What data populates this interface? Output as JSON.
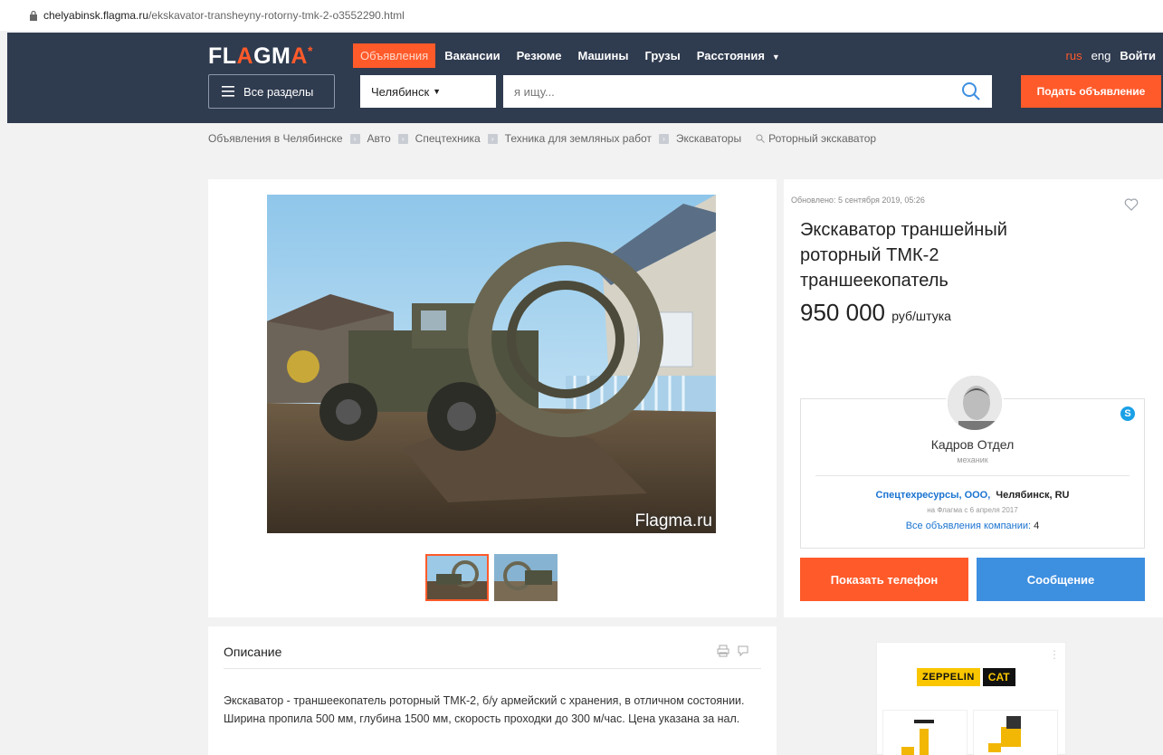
{
  "url": {
    "host": "chelyabinsk.flagma.ru",
    "path": "/ekskavator-transheyny-rotorny-tmk-2-o3552290.html"
  },
  "header": {
    "logo": "FLAGMA",
    "nav": [
      "Объявления",
      "Вакансии",
      "Резюме",
      "Машины",
      "Грузы",
      "Расстояния"
    ],
    "lang_rus": "rus",
    "lang_eng": "eng",
    "login": "Войти",
    "sections": "Все разделы",
    "city": "Челябинск",
    "search_placeholder": "я ищу...",
    "post_ad": "Подать объявление"
  },
  "breadcrumb": [
    "Объявления в Челябинске",
    "Авто",
    "Спецтехника",
    "Техника для земляных работ",
    "Экскаваторы",
    "Роторный экскаватор"
  ],
  "gallery": {
    "watermark": "Flagma.ru"
  },
  "listing": {
    "updated": "Обновлено: 5 сентября 2019, 05:26",
    "title": "Экскаватор траншейный роторный ТМК-2 траншеекопатель",
    "price": "950 000",
    "price_unit": "руб/штука"
  },
  "seller": {
    "name": "Кадров Отдел",
    "role": "механик",
    "company": "Спецтехресурсы, ООО,",
    "location": "Челябинск, RU",
    "since": "на Флагма с 6 апреля 2017",
    "all_ads_label": "Все объявления компании:",
    "all_ads_count": "4",
    "skype": "S"
  },
  "actions": {
    "phone": "Показать телефон",
    "message": "Сообщение"
  },
  "description": {
    "title": "Описание",
    "text": "Экскаватор - траншеекопатель роторный ТМК-2, б/у армейский с хранения, в отличном состоянии. Ширина пропила 500 мм, глубина 1500 мм, скорость проходки до 300 м/час. Цена указана за нал."
  },
  "ad": {
    "brand1": "ZEPPELIN",
    "brand2": "CAT"
  },
  "colors": {
    "header": "#2f3b4f",
    "accent": "#ff5a2a",
    "blue": "#3d8fe0",
    "link": "#1a73d0"
  }
}
